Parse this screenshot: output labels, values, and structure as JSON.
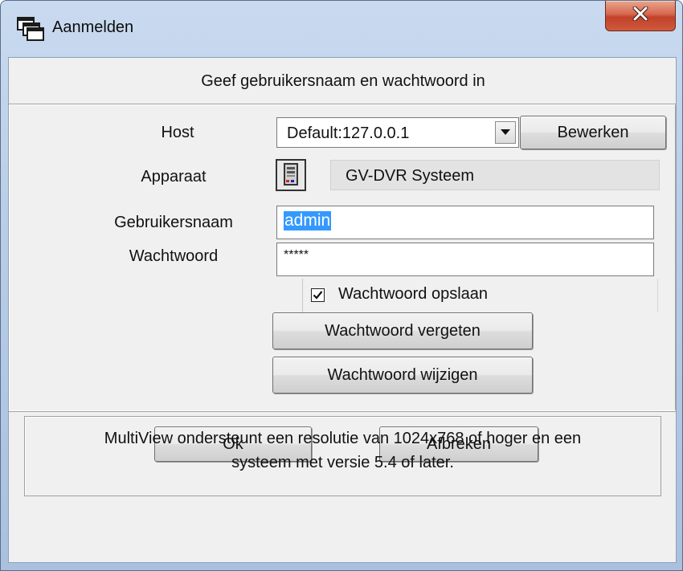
{
  "window": {
    "title": "Aanmelden",
    "close_icon": "close-x-icon"
  },
  "instruction": "Geef gebruikersnaam en wachtwoord in",
  "host": {
    "label": "Host",
    "value": "Default:127.0.0.1",
    "edit_button": "Bewerken"
  },
  "device": {
    "label": "Apparaat",
    "icon": "dvr-device-icon",
    "value": "GV-DVR Systeem"
  },
  "username": {
    "label": "Gebruikersnaam",
    "value": "admin"
  },
  "password": {
    "label": "Wachtwoord",
    "value": "*****"
  },
  "save_password": {
    "label": "Wachtwoord opslaan",
    "checked": true
  },
  "buttons": {
    "forgot": "Wachtwoord vergeten",
    "change": "Wachtwoord wijzigen",
    "ok": "Ok",
    "cancel": "Afbreken"
  },
  "info": {
    "line1": "MultiView ondersteunt een resolutie van 1024x768 of hoger en een",
    "line2": "systeem met versie 5.4 of later."
  }
}
